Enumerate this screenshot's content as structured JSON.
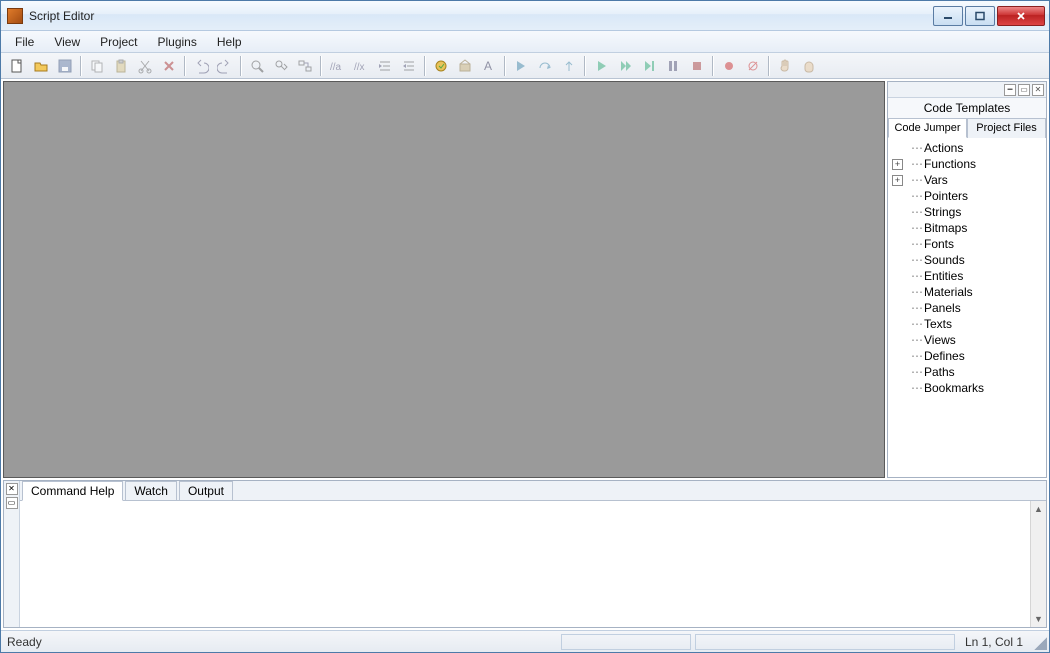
{
  "window": {
    "title": "Script Editor"
  },
  "menubar": [
    "File",
    "View",
    "Project",
    "Plugins",
    "Help"
  ],
  "toolbar_groups": [
    [
      {
        "name": "new-file-icon",
        "disabled": false
      },
      {
        "name": "open-file-icon",
        "disabled": false
      },
      {
        "name": "save-icon",
        "disabled": true
      }
    ],
    [
      {
        "name": "copy-icon",
        "disabled": true
      },
      {
        "name": "paste-icon",
        "disabled": true
      },
      {
        "name": "cut-icon",
        "disabled": true
      },
      {
        "name": "delete-icon",
        "disabled": true
      }
    ],
    [
      {
        "name": "undo-icon",
        "disabled": true
      },
      {
        "name": "redo-icon",
        "disabled": true
      }
    ],
    [
      {
        "name": "find-icon",
        "disabled": true
      },
      {
        "name": "find-next-icon",
        "disabled": true
      },
      {
        "name": "replace-icon",
        "disabled": true
      }
    ],
    [
      {
        "name": "comment-icon",
        "disabled": true
      },
      {
        "name": "uncomment-icon",
        "disabled": true
      },
      {
        "name": "indent-icon",
        "disabled": true
      },
      {
        "name": "outdent-icon",
        "disabled": true
      }
    ],
    [
      {
        "name": "compile-icon",
        "disabled": false
      },
      {
        "name": "build-icon",
        "disabled": true
      },
      {
        "name": "font-icon",
        "disabled": true
      }
    ],
    [
      {
        "name": "step-in-icon",
        "disabled": true
      },
      {
        "name": "step-over-icon",
        "disabled": true
      },
      {
        "name": "step-out-icon",
        "disabled": true
      }
    ],
    [
      {
        "name": "run-icon",
        "disabled": true
      },
      {
        "name": "continue-icon",
        "disabled": true
      },
      {
        "name": "run-to-icon",
        "disabled": true
      },
      {
        "name": "pause-icon",
        "disabled": true
      },
      {
        "name": "stop-icon",
        "disabled": true
      }
    ],
    [
      {
        "name": "breakpoint-icon",
        "disabled": true
      },
      {
        "name": "breakpoint-clear-icon",
        "disabled": true
      }
    ],
    [
      {
        "name": "hand-icon",
        "disabled": true
      },
      {
        "name": "grab-icon",
        "disabled": true
      }
    ]
  ],
  "side_panel": {
    "title": "Code Templates",
    "tabs": [
      "Code Jumper",
      "Project Files"
    ],
    "active_tab": 0,
    "tree": [
      {
        "label": "Actions",
        "expandable": false
      },
      {
        "label": "Functions",
        "expandable": true
      },
      {
        "label": "Vars",
        "expandable": true
      },
      {
        "label": "Pointers",
        "expandable": false
      },
      {
        "label": "Strings",
        "expandable": false
      },
      {
        "label": "Bitmaps",
        "expandable": false
      },
      {
        "label": "Fonts",
        "expandable": false
      },
      {
        "label": "Sounds",
        "expandable": false
      },
      {
        "label": "Entities",
        "expandable": false
      },
      {
        "label": "Materials",
        "expandable": false
      },
      {
        "label": "Panels",
        "expandable": false
      },
      {
        "label": "Texts",
        "expandable": false
      },
      {
        "label": "Views",
        "expandable": false
      },
      {
        "label": "Defines",
        "expandable": false
      },
      {
        "label": "Paths",
        "expandable": false
      },
      {
        "label": "Bookmarks",
        "expandable": false
      }
    ]
  },
  "bottom_panel": {
    "tabs": [
      "Command Help",
      "Watch",
      "Output"
    ],
    "active_tab": 0
  },
  "statusbar": {
    "left": "Ready",
    "pos": "Ln 1, Col 1"
  }
}
